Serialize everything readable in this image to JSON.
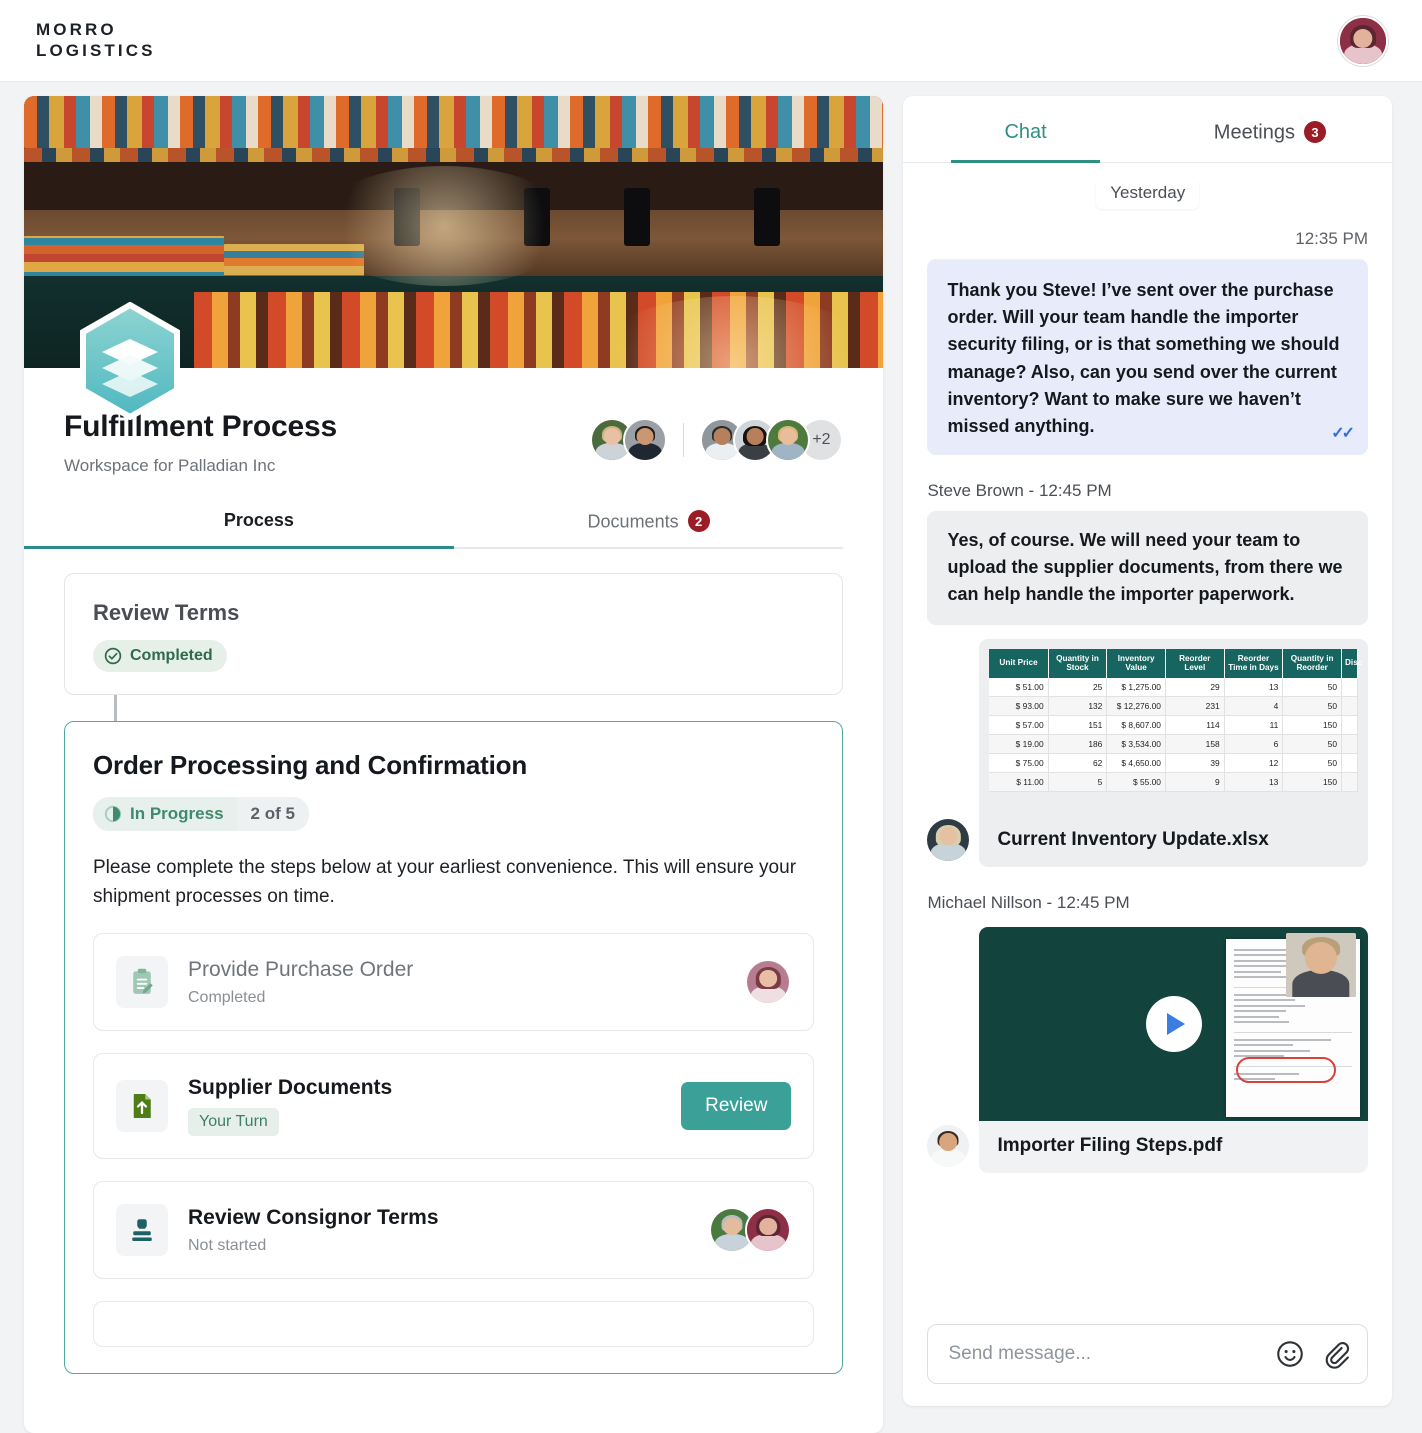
{
  "brand": {
    "line1": "MORRO",
    "line2": "LOGISTICS"
  },
  "header": {
    "avatar_alt": "user-avatar"
  },
  "workspace": {
    "title": "Fulfillment Process",
    "subtitle": "Workspace for Palladian Inc",
    "extra_members": "+2"
  },
  "tabs": [
    {
      "label": "Process",
      "badge": ""
    },
    {
      "label": "Documents",
      "badge": "2"
    }
  ],
  "steps": {
    "completed_step": {
      "title": "Review Terms",
      "status": "Completed",
      "status_icon": "check-circle-icon"
    },
    "active_step": {
      "title": "Order Processing and Confirmation",
      "status": "In Progress",
      "status_icon": "half-circle-icon",
      "count": "2 of 5",
      "description": "Please complete the steps below at your earliest convenience. This will ensure your shipment processes on time."
    },
    "tasks": [
      {
        "title": "Provide Purchase Order",
        "subtitle": "Completed",
        "icon": "clipboard-icon",
        "action": ""
      },
      {
        "title": "Supplier Documents",
        "tag": "Your Turn",
        "icon": "upload-file-icon",
        "action": "Review"
      },
      {
        "title": "Review Consignor Terms",
        "subtitle": "Not started",
        "icon": "stamp-icon",
        "action": ""
      }
    ]
  },
  "chat": {
    "tabs": [
      {
        "label": "Chat",
        "badge": ""
      },
      {
        "label": "Meetings",
        "badge": "3"
      }
    ],
    "day_separator": "Yesterday",
    "messages": [
      {
        "type": "outgoing",
        "time": "12:35 PM",
        "text": "Thank you Steve! I’ve sent over the purchase order.  Will your team handle the importer security filing, or is that something we should manage? Also, can you send over the current inventory? Want to make sure we haven’t missed anything.",
        "read_receipt": "double-check-icon"
      },
      {
        "type": "incoming",
        "sender": "Steve Brown - 12:45 PM",
        "text": "Yes, of course. We will need your team to upload the supplier documents, from there we can help handle the importer paperwork."
      },
      {
        "type": "attachment-spreadsheet",
        "filename": "Current Inventory Update.xlsx"
      },
      {
        "type": "attachment-video",
        "sender": "Michael Nillson - 12:45 PM",
        "filename": "Importer Filing Steps.pdf",
        "play_icon": "play-icon"
      }
    ],
    "composer": {
      "placeholder": "Send message...",
      "emoji_icon": "emoji-icon",
      "attach_icon": "paperclip-icon"
    }
  },
  "spreadsheet": {
    "columns": [
      "Unit Price",
      "Quantity in Stock",
      "Inventory Value",
      "Reorder Level",
      "Reorder Time in Days",
      "Quantity in Reorder",
      "Disc"
    ],
    "rows": [
      [
        "$ 51.00",
        "25",
        "$ 1,275.00",
        "29",
        "13",
        "50",
        ""
      ],
      [
        "$ 93.00",
        "132",
        "$ 12,276.00",
        "231",
        "4",
        "50",
        ""
      ],
      [
        "$ 57.00",
        "151",
        "$ 8,607.00",
        "114",
        "11",
        "150",
        ""
      ],
      [
        "$ 19.00",
        "186",
        "$ 3,534.00",
        "158",
        "6",
        "50",
        ""
      ],
      [
        "$ 75.00",
        "62",
        "$ 4,650.00",
        "39",
        "12",
        "50",
        ""
      ],
      [
        "$ 11.00",
        "5",
        "$ 55.00",
        "9",
        "13",
        "150",
        ""
      ]
    ]
  },
  "colors": {
    "accent_teal": "#2b8c8c",
    "button_teal": "#3ba198",
    "badge_red": "#9b1c26",
    "chat_accent": "#2e8f82",
    "outgoing_bubble": "#e8ecfa",
    "incoming_bubble": "#eceef0",
    "sheet_header": "#176560",
    "video_bg": "#12433d"
  }
}
